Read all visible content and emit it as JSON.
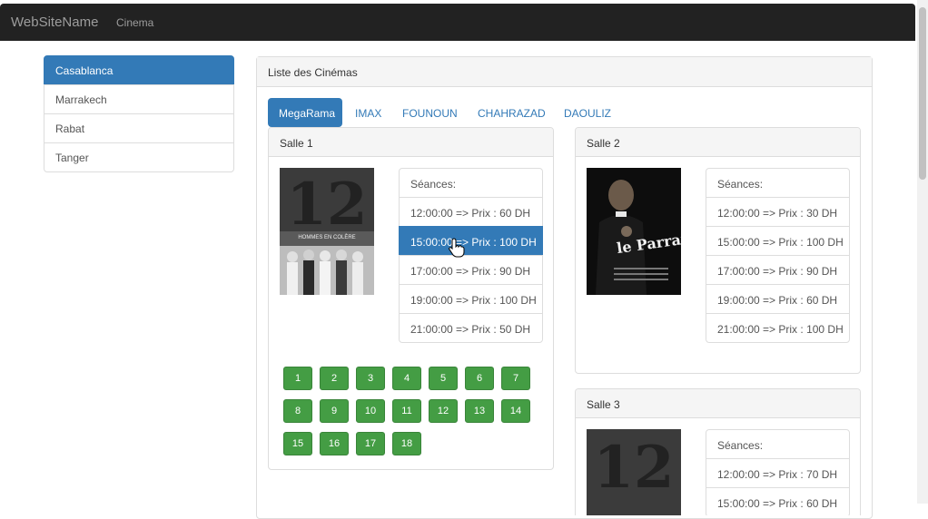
{
  "navbar": {
    "brand": "WebSiteName",
    "link": "Cinema"
  },
  "cities": [
    "Casablanca",
    "Marrakech",
    "Rabat",
    "Tanger"
  ],
  "main": {
    "title": "Liste des Cinémas",
    "tabs": [
      "MegaRama",
      "IMAX",
      "FOUNOUN",
      "CHAHRAZAD",
      "DAOULIZ"
    ]
  },
  "salles": [
    {
      "title": "Salle 1",
      "poster": {
        "text": "HOMMES EN COLÈRE"
      },
      "seances_label": "Séances:",
      "seances": [
        "12:00:00 => Prix : 60 DH",
        "15:00:00 => Prix : 100 DH",
        "17:00:00 => Prix : 90 DH",
        "19:00:00 => Prix : 100 DH",
        "21:00:00 => Prix : 50 DH"
      ],
      "selected_seance": 1,
      "places": [
        "1",
        "2",
        "3",
        "4",
        "5",
        "6",
        "7",
        "8",
        "9",
        "10",
        "11",
        "12",
        "13",
        "14",
        "15",
        "16",
        "17",
        "18"
      ]
    },
    {
      "title": "Salle 2",
      "poster": {
        "title": "le Parrain"
      },
      "seances_label": "Séances:",
      "seances": [
        "12:00:00 => Prix : 30 DH",
        "15:00:00 => Prix : 100 DH",
        "17:00:00 => Prix : 90 DH",
        "19:00:00 => Prix : 60 DH",
        "21:00:00 => Prix : 100 DH"
      ]
    },
    {
      "title": "Salle 3",
      "seances_label": "Séances:",
      "seances": [
        "12:00:00 => Prix : 70 DH",
        "15:00:00 => Prix : 60 DH"
      ]
    }
  ],
  "colors": {
    "primary": "#337ab7",
    "seat": "#449d44",
    "navbar": "#222222"
  }
}
